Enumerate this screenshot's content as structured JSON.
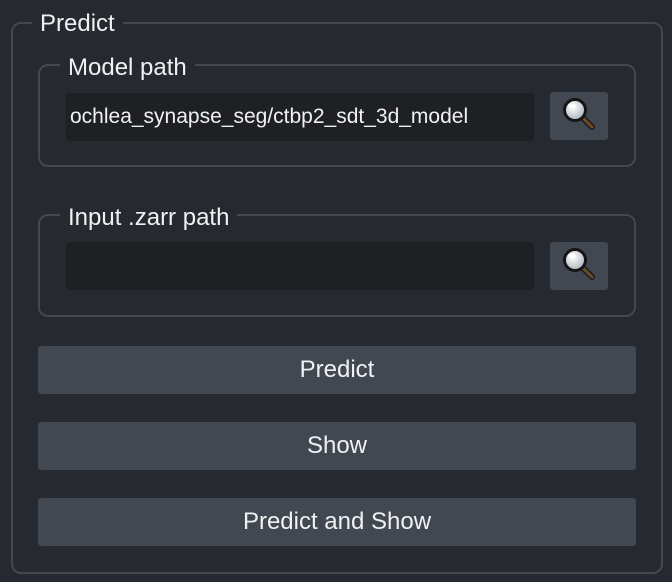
{
  "predict_group": {
    "title": "Predict"
  },
  "model_path": {
    "label": "Model path",
    "value": "ochlea_synapse_seg/ctbp2_sdt_3d_model",
    "browse_icon": "magnifier-icon"
  },
  "input_zarr_path": {
    "label": "Input .zarr path",
    "value": "",
    "browse_icon": "magnifier-icon"
  },
  "buttons": {
    "predict": "Predict",
    "show": "Show",
    "predict_and_show": "Predict and Show"
  },
  "colors": {
    "background": "#262930",
    "border": "#414851",
    "button": "#414851",
    "field": "#1e2024",
    "text": "#f0f1f2"
  }
}
